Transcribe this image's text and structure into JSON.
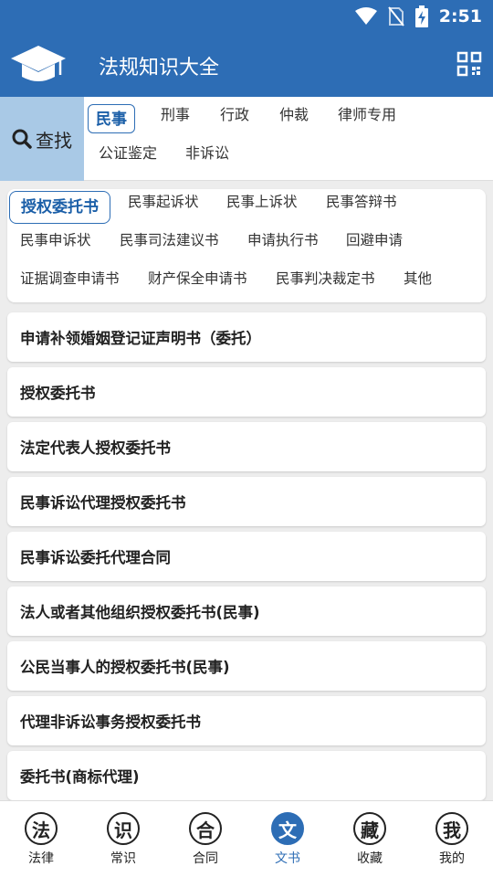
{
  "status_bar": {
    "time": "2:51",
    "icons": [
      "wifi-icon",
      "no-sim-icon",
      "battery-charging-icon"
    ]
  },
  "app_bar": {
    "title": "法规知识大全",
    "logo_icon": "graduation-cap-icon",
    "qr_icon": "qr-scan-icon"
  },
  "search": {
    "label": "查找",
    "icon": "search-icon"
  },
  "categories": [
    "民事",
    "刑事",
    "行政",
    "仲裁",
    "律师专用",
    "公证鉴定",
    "非诉讼"
  ],
  "active_category": "民事",
  "sub_categories": [
    "授权委托书",
    "民事起诉状",
    "民事上诉状",
    "民事答辩书",
    "民事申诉状",
    "民事司法建议书",
    "申请执行书",
    "回避申请",
    "证据调查申请书",
    "财产保全申请书",
    "民事判决裁定书",
    "其他"
  ],
  "active_sub_category": "授权委托书",
  "documents": [
    "申请补领婚姻登记证声明书（委托）",
    "授权委托书",
    "法定代表人授权委托书",
    "民事诉讼代理授权委托书",
    "民事诉讼委托代理合同",
    "法人或者其他组织授权委托书(民事)",
    "公民当事人的授权委托书(民事)",
    "代理非诉讼事务授权委托书",
    "委托书(商标代理)"
  ],
  "bottom_nav": [
    {
      "glyph": "法",
      "label": "法律"
    },
    {
      "glyph": "识",
      "label": "常识"
    },
    {
      "glyph": "合",
      "label": "合同"
    },
    {
      "glyph": "文",
      "label": "文书"
    },
    {
      "glyph": "藏",
      "label": "收藏"
    },
    {
      "glyph": "我",
      "label": "我的"
    }
  ],
  "active_nav": "文书",
  "colors": {
    "primary": "#2d6db5",
    "search_bg": "#a9c9e6",
    "page_bg": "#ededed"
  }
}
